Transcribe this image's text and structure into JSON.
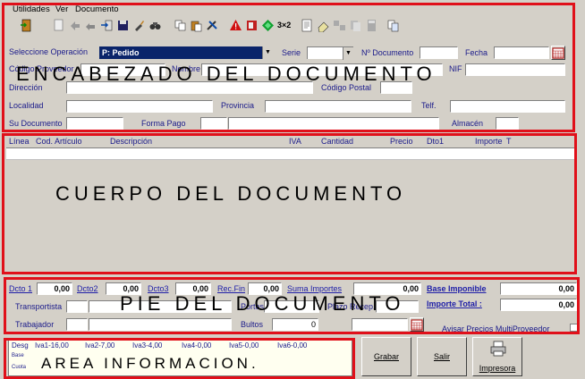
{
  "menu": {
    "items": [
      "Utilidades",
      "Ver",
      "Documento"
    ]
  },
  "header": {
    "overlay": "ENCABEZADO DEL DOCUMENTO",
    "seleccione_operacion_label": "Seleccione Operación",
    "operacion_value": "P: Pedido",
    "serie_label": "Serie",
    "num_documento_label": "Nº Documento",
    "fecha_label": "Fecha",
    "codigo_proveedor_label": "Código Proveedor",
    "nombre_label": "Nombre",
    "nif_label": "NIF",
    "direccion_label": "Dirección",
    "codigo_postal_label": "Código Postal",
    "localidad_label": "Localidad",
    "provincia_label": "Provincia",
    "telf_label": "Telf.",
    "su_documento_label": "Su Documento",
    "forma_pago_label": "Forma Pago",
    "almacen_label": "Almacén"
  },
  "grid": {
    "columns": [
      "Línea",
      "Cod. Artículo",
      "Descripción",
      "IVA",
      "Cantidad",
      "Precio",
      "Dto1",
      "Importe",
      "T"
    ],
    "overlay": "CUERPO DEL DOCUMENTO"
  },
  "footer": {
    "overlay": "PIE DEL DOCUMENTO",
    "dcto1_label": "Dcto 1",
    "dcto1_value": "0,00",
    "dcto2_label": "Dcto2",
    "dcto2_value": "0,00",
    "dcto3_label": "Dcto3",
    "dcto3_value": "0,00",
    "recfin_label": "Rec.Fin",
    "recfin_value": "0,00",
    "suma_importes_label": "Suma Importes",
    "suma_importes_value": "0,00",
    "base_imponible_label": "Base Imponible",
    "base_imponible_value": "0,00",
    "importe_total_label": "Importe Total :",
    "importe_total_value": "0,00",
    "transportista_label": "Transportista",
    "portes_label": "Portes",
    "plazo_recep_label": "Plazo Recep.",
    "trabajador_label": "Trabajador",
    "bultos_label": "Bultos",
    "bultos_value": "0",
    "avisar_label": "Avisar Precios MultiProveedor"
  },
  "info": {
    "overlay": "AREA INFORMACION.",
    "desg_label": "Desg",
    "iva_headers": [
      "Iva1-16,00",
      "Iva2-7,00",
      "Iva3-4,00",
      "Iva4-0,00",
      "Iva5-0,00",
      "Iva6-0,00"
    ],
    "base_label": "Base",
    "cuota_label": "Cuota"
  },
  "buttons": {
    "grabar": "Grabar",
    "salir": "Salir",
    "impresora": "Impresora"
  }
}
